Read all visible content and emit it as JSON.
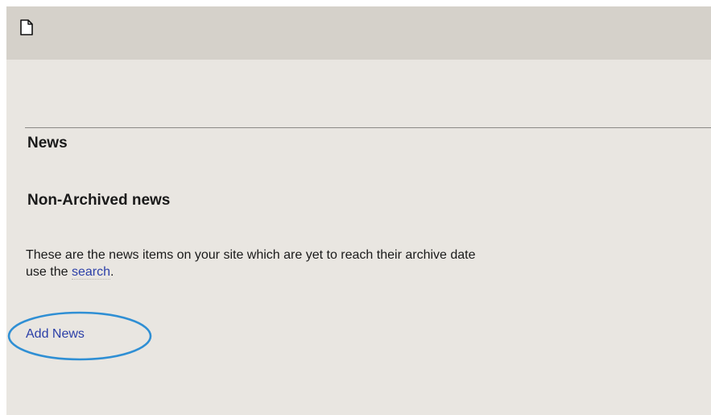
{
  "toolbar": {
    "icon": "page-icon"
  },
  "content": {
    "section_title": "News",
    "subsection_title": "Non-Archived news",
    "intro_text_before_link": "These are the news items on your site which are yet to reach their archive date",
    "intro_text_line2_prefix": "use the ",
    "search_link_label": "search",
    "intro_text_suffix": ".",
    "add_news_label": "Add News"
  },
  "annotation": {
    "highlight_color": "#2f8fd4",
    "highlight_target": "Add News"
  }
}
